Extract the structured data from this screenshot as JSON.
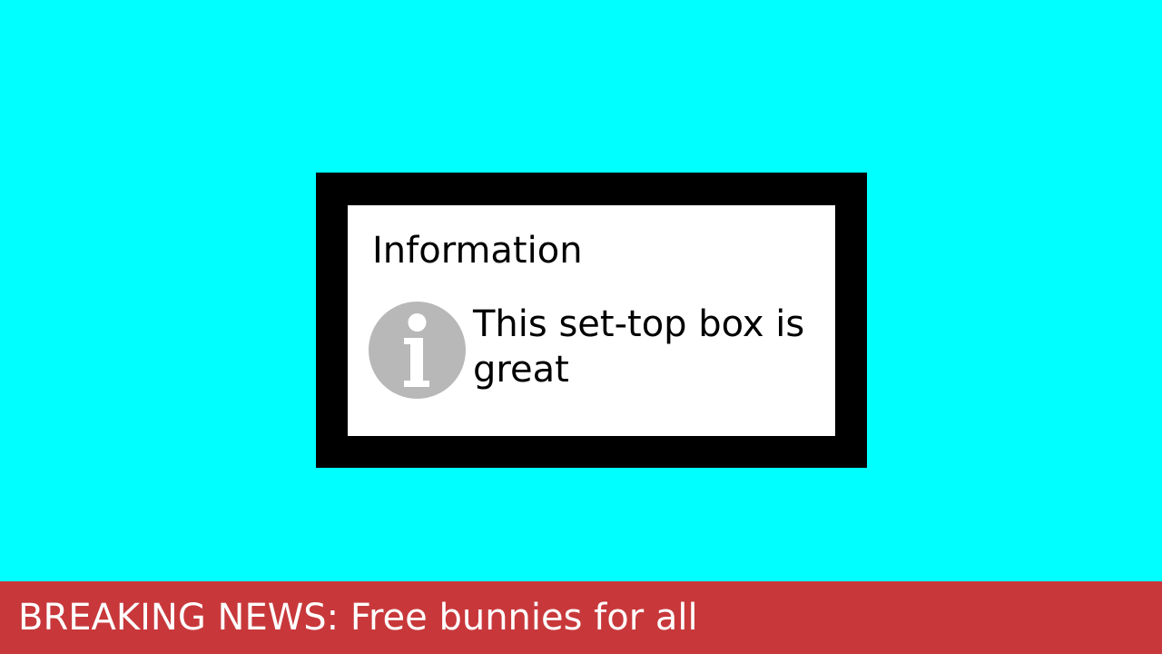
{
  "colors": {
    "background": "#00ffff",
    "dialog_frame": "#000000",
    "dialog_body": "#ffffff",
    "icon_fill": "#b8b8b8",
    "news_bar": "#c8383b",
    "news_text": "#ffffff"
  },
  "dialog": {
    "title": "Information",
    "icon": "info-icon",
    "message": "This set-top box is great"
  },
  "ticker": {
    "text": "BREAKING NEWS: Free bunnies for all"
  }
}
